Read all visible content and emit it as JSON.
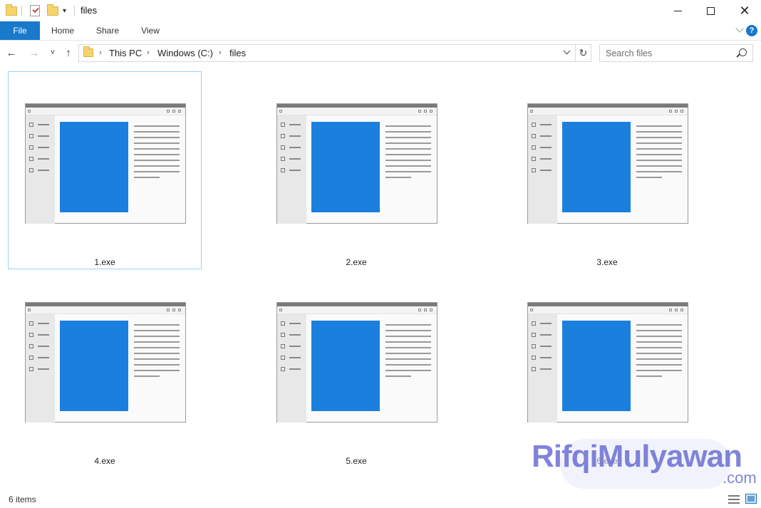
{
  "window": {
    "title": "files",
    "controls": {
      "minimize_icon": "minimize-icon",
      "maximize_icon": "maximize-icon",
      "close_icon": "close-icon"
    }
  },
  "quick_access": {
    "customize_glyph": "▾"
  },
  "ribbon": {
    "tabs": [
      {
        "label": "File",
        "active": true
      },
      {
        "label": "Home"
      },
      {
        "label": "Share"
      },
      {
        "label": "View"
      }
    ],
    "help_glyph": "?"
  },
  "nav": {
    "back_glyph": "←",
    "forward_glyph": "→",
    "recent_glyph": "˅",
    "up_glyph": "↑",
    "breadcrumb": [
      "This PC",
      "Windows (C:)",
      "files"
    ],
    "breadcrumb_sep": "›",
    "refresh_glyph": "↻"
  },
  "search": {
    "placeholder": "Search files"
  },
  "files": [
    {
      "name": "1.exe",
      "selected": true
    },
    {
      "name": "2.exe"
    },
    {
      "name": "3.exe"
    },
    {
      "name": "4.exe"
    },
    {
      "name": "5.exe"
    },
    {
      "name": "6.exe"
    }
  ],
  "status": {
    "item_count": "6 items"
  },
  "watermark": {
    "name": "RifqiMulyawan",
    "domain": ".com"
  },
  "colors": {
    "accent": "#1979ca",
    "thumbnail_blue": "#1a7fdd",
    "selection_border": "#99d1ff"
  }
}
